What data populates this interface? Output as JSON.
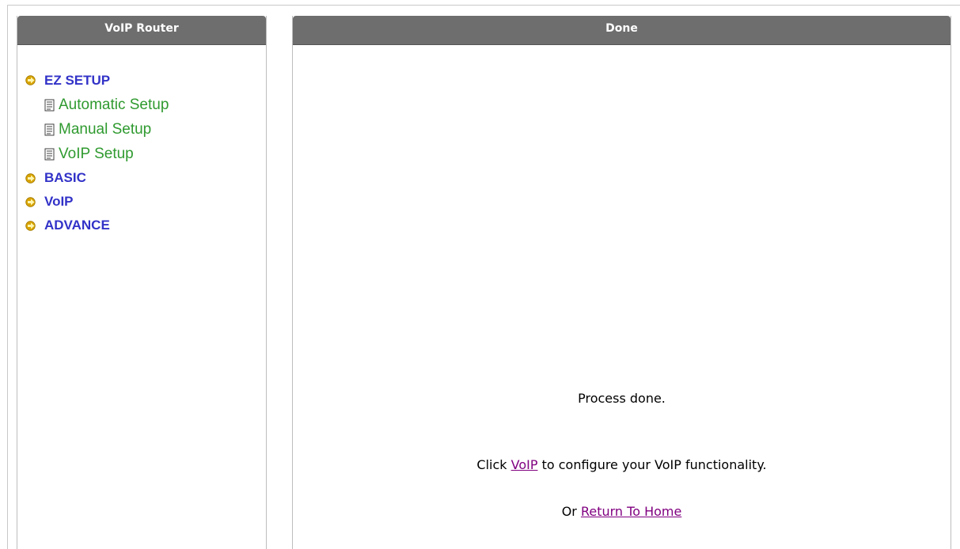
{
  "sidebar": {
    "title": "VoIP Router",
    "groups": [
      {
        "label": "EZ SETUP",
        "items": [
          {
            "label": "Automatic Setup"
          },
          {
            "label": "Manual Setup"
          },
          {
            "label": "VoIP Setup"
          }
        ]
      },
      {
        "label": "BASIC"
      },
      {
        "label": "VoIP"
      },
      {
        "label": "ADVANCE"
      }
    ]
  },
  "main": {
    "title": "Done",
    "process_text": "Process done.",
    "click_prefix": "Click",
    "voip_link": "VoIP",
    "click_suffix": "to configure your VoIP functionality.",
    "or_text": "Or",
    "home_link": "Return To Home"
  },
  "colors": {
    "header_bg": "#6e6e6e",
    "group_text": "#3232c8",
    "sub_item_text": "#2f9a2f",
    "visited_link": "#800080"
  },
  "icons": {
    "group_marker": "arrow-right-icon",
    "sub_item_marker": "document-icon"
  }
}
